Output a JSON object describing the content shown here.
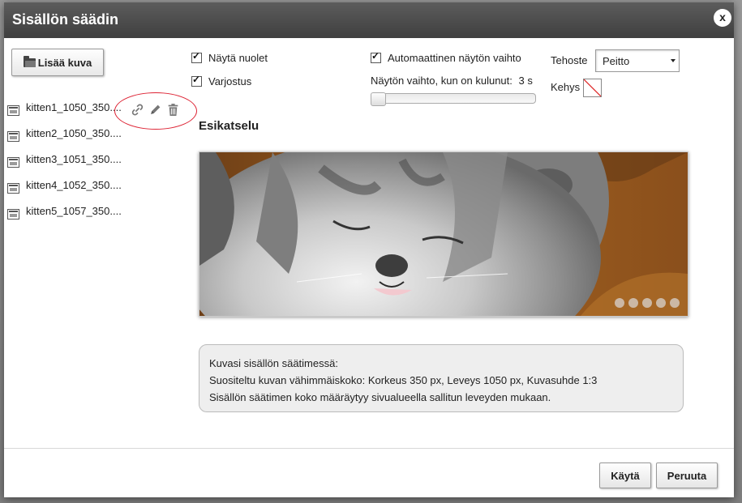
{
  "dialog": {
    "title": "Sisällön säädin",
    "close_label": "x"
  },
  "toolbar": {
    "add_image_label": "Lisää kuva"
  },
  "files": [
    {
      "name": "kitten1_1050_350...."
    },
    {
      "name": "kitten2_1050_350...."
    },
    {
      "name": "kitten3_1051_350...."
    },
    {
      "name": "kitten4_1052_350...."
    },
    {
      "name": "kitten5_1057_350...."
    }
  ],
  "file_actions": {
    "icons": [
      "link-icon",
      "pencil-icon",
      "trash-icon"
    ]
  },
  "options": {
    "show_arrows": {
      "label": "Näytä nuolet",
      "checked": true
    },
    "shadow": {
      "label": "Varjostus",
      "checked": true
    },
    "auto_switch": {
      "label": "Automaattinen näytön vaihto",
      "checked": true
    },
    "interval_label": "Näytön vaihto, kun on kulunut:",
    "interval_value": "3 s",
    "interval_slider_level": 0.0
  },
  "effect": {
    "label": "Tehoste",
    "selected": "Peitto"
  },
  "frame": {
    "label": "Kehys",
    "value": "none"
  },
  "preview": {
    "title": "Esikatselu",
    "slide_count": 5
  },
  "info": {
    "line1": "Kuvasi sisällön säätimessä:",
    "line2": "Suositeltu kuvan vähimmäiskoko: Korkeus 350 px, Leveys 1050 px, Kuvasuhde 1:3",
    "line3": "Sisällön säätimen koko määräytyy sivualueella sallitun leveyden mukaan."
  },
  "footer": {
    "apply_label": "Käytä",
    "cancel_label": "Peruuta"
  },
  "colors": {
    "titlebar": "#4a4a4a",
    "annotation_circle": "#dd2233",
    "info_bg": "#eeeeee"
  }
}
